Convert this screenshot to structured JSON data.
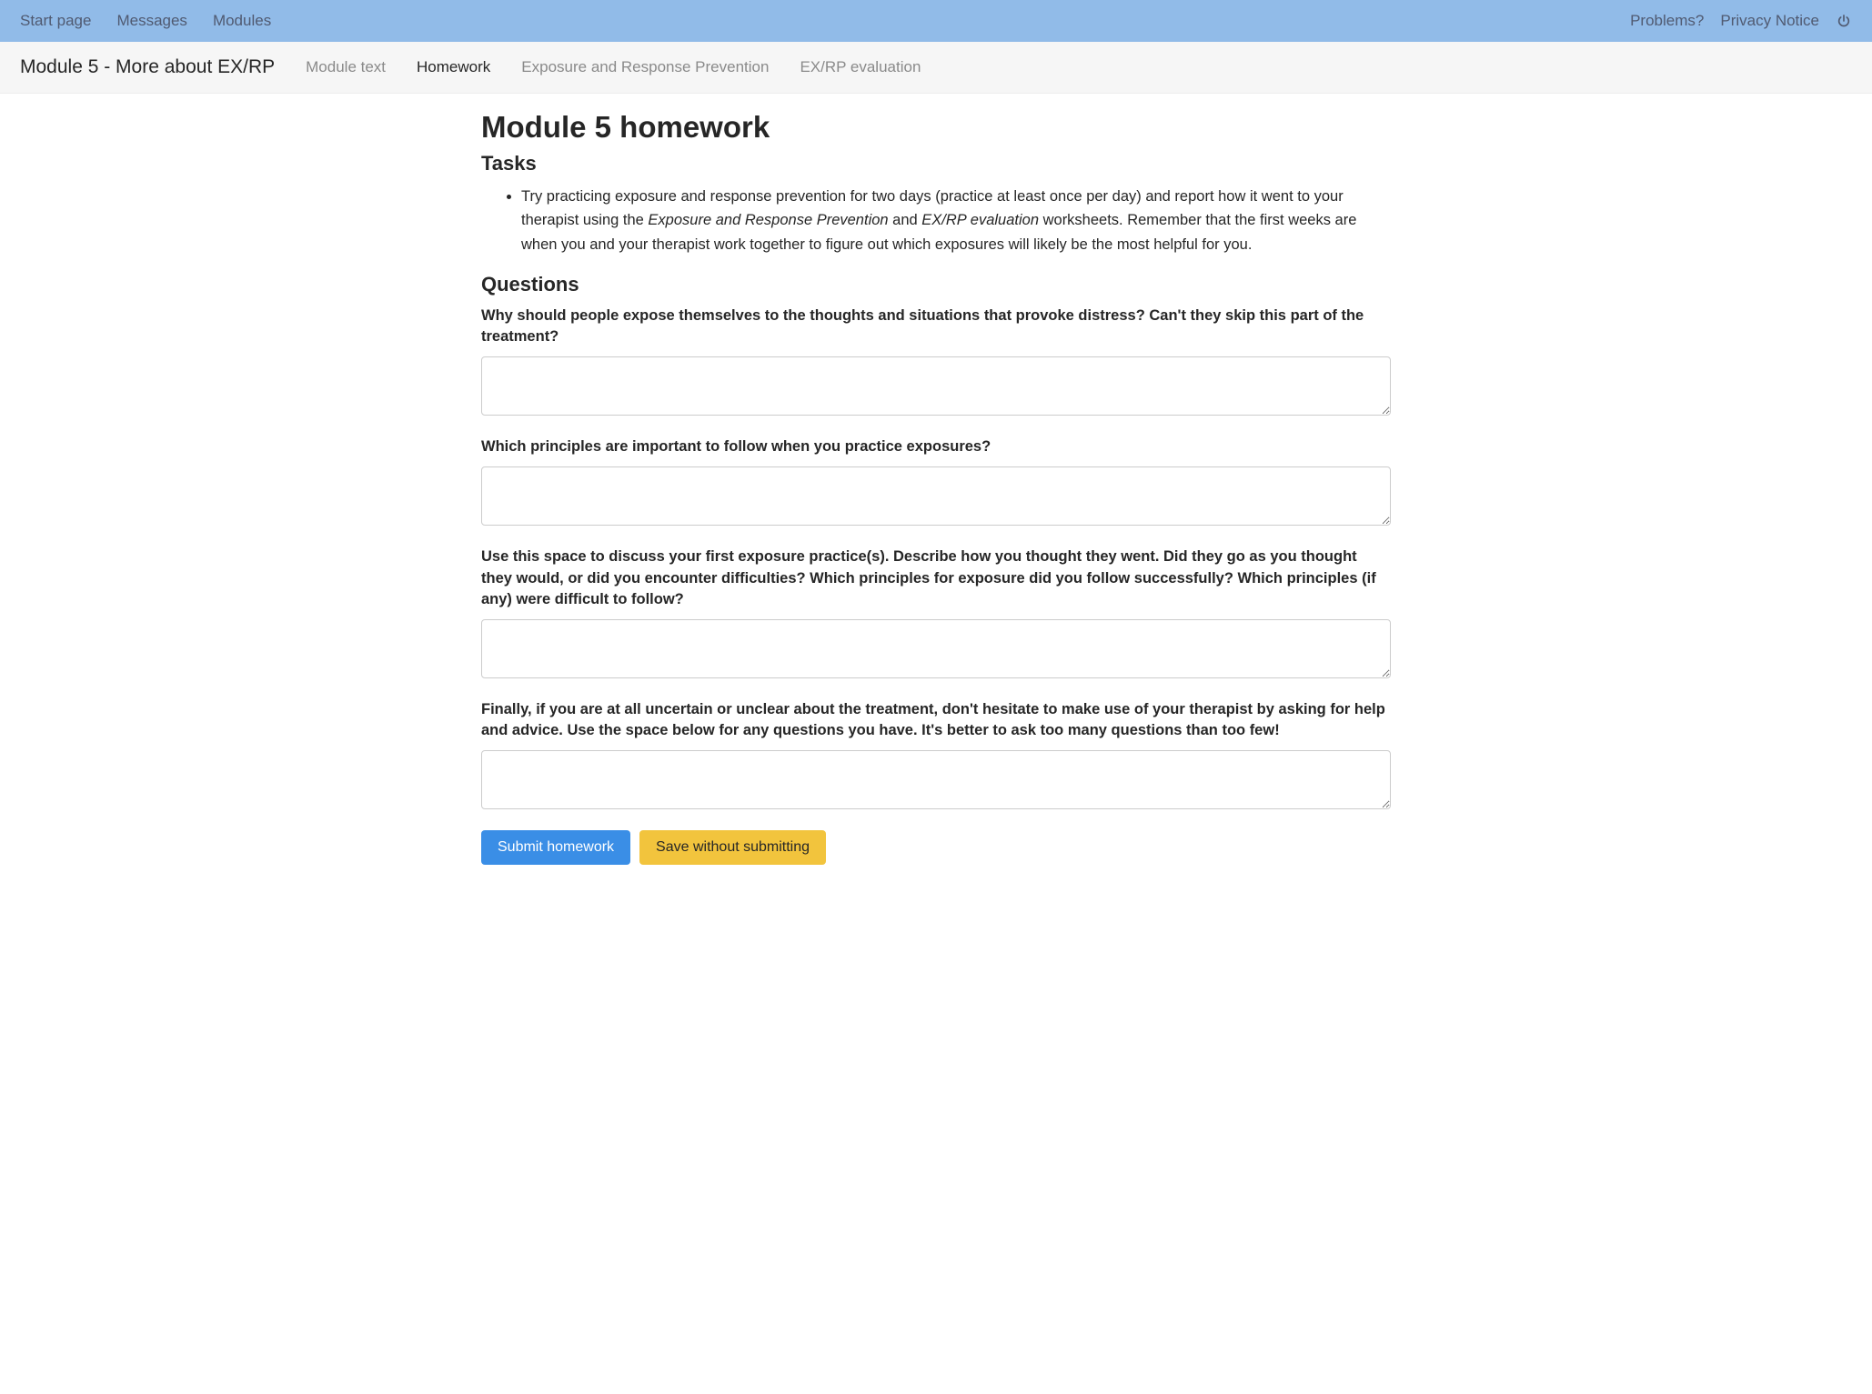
{
  "topNav": {
    "left": [
      {
        "label": "Start page"
      },
      {
        "label": "Messages"
      },
      {
        "label": "Modules"
      }
    ],
    "right": [
      {
        "label": "Problems?"
      },
      {
        "label": "Privacy Notice"
      }
    ]
  },
  "subNav": {
    "title": "Module 5 - More about EX/RP",
    "tabs": [
      {
        "label": "Module text",
        "active": false
      },
      {
        "label": "Homework",
        "active": true
      },
      {
        "label": "Exposure and Response Prevention",
        "active": false
      },
      {
        "label": "EX/RP evaluation",
        "active": false
      }
    ]
  },
  "page": {
    "heading": "Module 5 homework",
    "tasksHeading": "Tasks",
    "taskText1": "Try practicing exposure and response prevention for two days (practice at least once per day) and report how it went to your therapist using the ",
    "taskEm1": "Exposure and Response Prevention",
    "taskAnd": " and ",
    "taskEm2": "EX/RP evaluation",
    "taskText2": " worksheets. Remember that the first weeks are when you and your therapist work together to figure out which exposures will likely be the most helpful for you.",
    "questionsHeading": "Questions",
    "questions": [
      {
        "label": "Why should people expose themselves to the thoughts and situations that provoke distress? Can't they skip this part of the treatment?"
      },
      {
        "label": "Which principles are important to follow when you practice exposures?"
      },
      {
        "label": "Use this space to discuss your first exposure practice(s). Describe how you thought they went. Did they go as you thought they would, or did you encounter difficulties? Which principles for exposure did you follow successfully? Which principles (if any) were difficult to follow?"
      },
      {
        "label": "Finally, if you are at all uncertain or unclear about the treatment, don't hesitate to make use of your therapist by asking for help and advice. Use the space below for any questions you have. It's better to ask too many questions than too few!"
      }
    ],
    "buttons": {
      "submit": "Submit homework",
      "save": "Save without submitting"
    }
  }
}
